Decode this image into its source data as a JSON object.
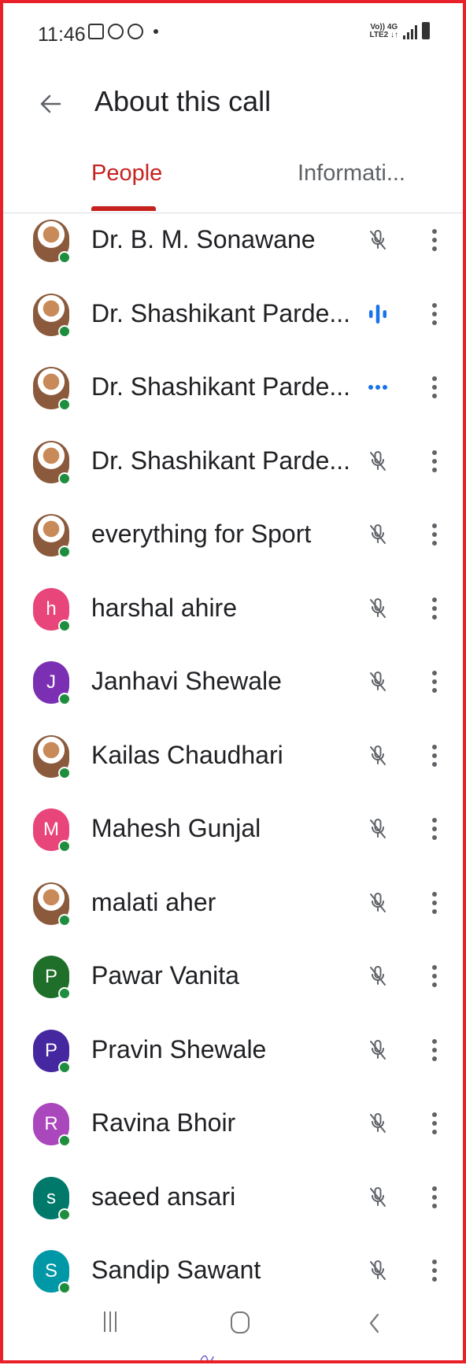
{
  "status_bar": {
    "time": "11:46",
    "network_top": "Vo)) 4G",
    "network_bottom": "LTE2 ↓↑"
  },
  "header": {
    "title": "About this call",
    "back_icon": "arrow-left-icon"
  },
  "tabs": [
    {
      "label": "People",
      "selected": true
    },
    {
      "label": "Informati..."
    }
  ],
  "colors": {
    "accent": "#c5221f",
    "presence": "#1e8e3e",
    "speaking": "#1a73e8",
    "icon_gray": "#5f6368"
  },
  "participants": [
    {
      "name": "Dr. B. M. Sonawane",
      "avatar_letter": "",
      "avatar_type": "photo",
      "mic": "muted"
    },
    {
      "name": "Dr. Shashikant Parde...",
      "avatar_letter": "",
      "avatar_type": "photo",
      "mic": "speaking"
    },
    {
      "name": "Dr. Shashikant Parde...",
      "avatar_letter": "",
      "avatar_type": "photo",
      "mic": "connecting"
    },
    {
      "name": "Dr. Shashikant Parde...",
      "avatar_letter": "",
      "avatar_type": "photo",
      "mic": "muted"
    },
    {
      "name": "everything for Sport",
      "avatar_letter": "",
      "avatar_type": "photo",
      "mic": "muted"
    },
    {
      "name": "harshal ahire",
      "avatar_letter": "h",
      "avatar_color": "#e8457a",
      "mic": "muted"
    },
    {
      "name": "Janhavi Shewale",
      "avatar_letter": "J",
      "avatar_color": "#7b2fb3",
      "mic": "muted"
    },
    {
      "name": "Kailas Chaudhari",
      "avatar_letter": "",
      "avatar_type": "photo",
      "mic": "muted"
    },
    {
      "name": "Mahesh Gunjal",
      "avatar_letter": "M",
      "avatar_color": "#e8457a",
      "mic": "muted"
    },
    {
      "name": "malati aher",
      "avatar_letter": "",
      "avatar_type": "photo",
      "mic": "muted"
    },
    {
      "name": "Pawar Vanita",
      "avatar_letter": "P",
      "avatar_color": "#1f6e2a",
      "mic": "muted"
    },
    {
      "name": "Pravin Shewale",
      "avatar_letter": "P",
      "avatar_color": "#4527a0",
      "mic": "muted"
    },
    {
      "name": "Ravina Bhoir",
      "avatar_letter": "R",
      "avatar_color": "#ab47bc",
      "mic": "muted"
    },
    {
      "name": "saeed ansari",
      "avatar_letter": "s",
      "avatar_color": "#00796b",
      "mic": "muted"
    },
    {
      "name": "Sandip Sawant",
      "avatar_letter": "S",
      "avatar_color": "#0097a7",
      "mic": "muted"
    }
  ],
  "nav_bar": {
    "recents_icon": "recents-icon",
    "home_icon": "home-icon",
    "back_icon": "back-chevron-icon"
  }
}
